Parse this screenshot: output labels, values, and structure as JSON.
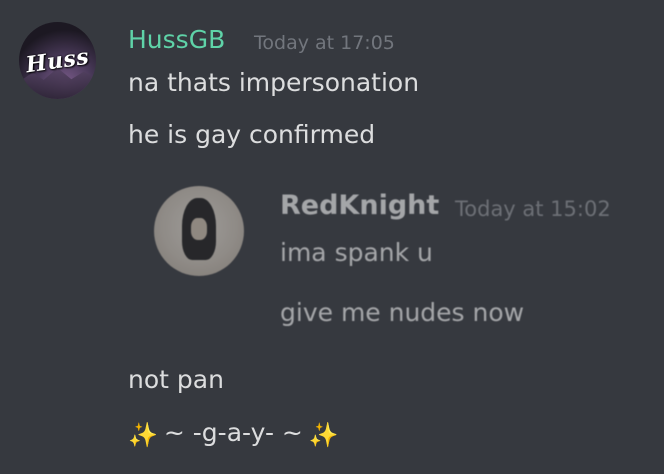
{
  "message": {
    "author": "HussGB",
    "timestamp": "Today at 17:05",
    "avatar_logo_text": "Huss",
    "lines": [
      "na thats impersonation",
      "he is gay confirmed",
      "not pan"
    ],
    "last_line": {
      "left_icon": "sparkles-icon",
      "text": "~ -g-a-y- ~",
      "right_icon": "sparkles-icon",
      "sparkle_glyph": "✨"
    }
  },
  "quoted": {
    "author": "RedKnight",
    "timestamp": "Today at 15:02",
    "lines": [
      "ima spank u",
      "give me nudes now"
    ]
  },
  "colors": {
    "background": "#36393f",
    "author_name": "#5fd3a8",
    "timestamp": "#72767d",
    "message_text": "#dcddde"
  }
}
